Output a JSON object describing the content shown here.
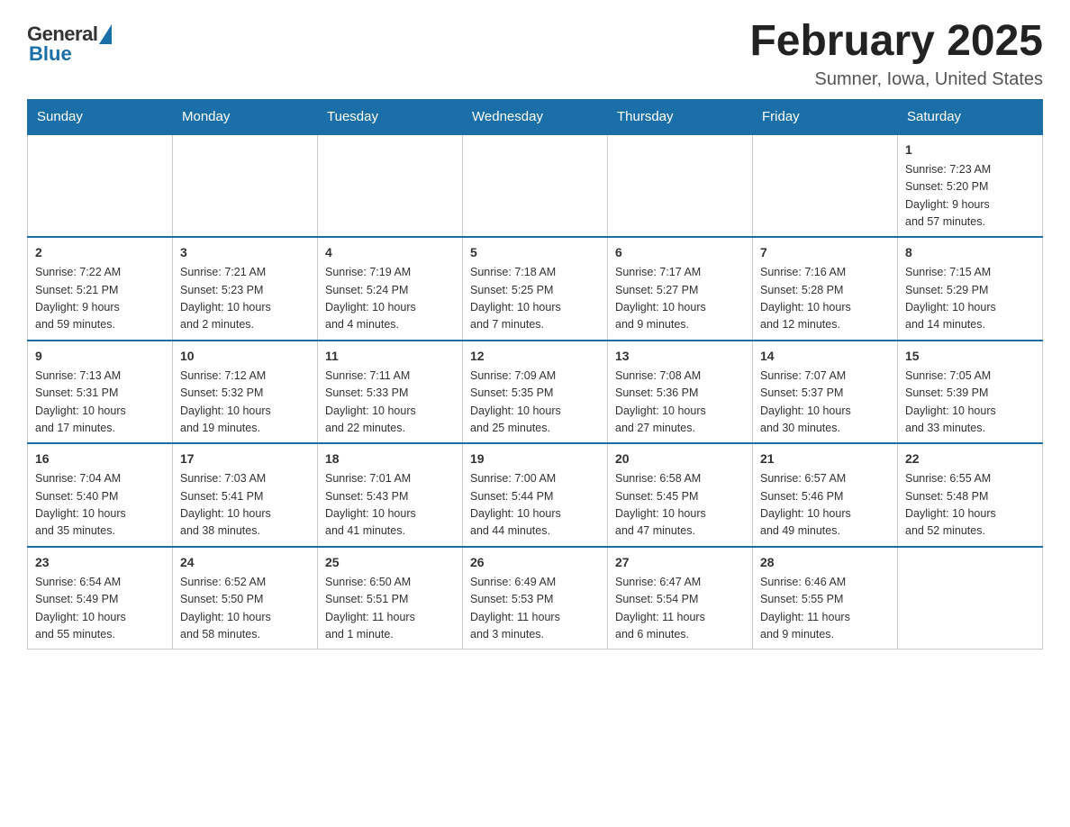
{
  "header": {
    "logo": {
      "general": "General",
      "blue": "Blue"
    },
    "title": "February 2025",
    "location": "Sumner, Iowa, United States"
  },
  "weekdays": [
    "Sunday",
    "Monday",
    "Tuesday",
    "Wednesday",
    "Thursday",
    "Friday",
    "Saturday"
  ],
  "weeks": [
    [
      {
        "day": "",
        "info": ""
      },
      {
        "day": "",
        "info": ""
      },
      {
        "day": "",
        "info": ""
      },
      {
        "day": "",
        "info": ""
      },
      {
        "day": "",
        "info": ""
      },
      {
        "day": "",
        "info": ""
      },
      {
        "day": "1",
        "info": "Sunrise: 7:23 AM\nSunset: 5:20 PM\nDaylight: 9 hours\nand 57 minutes."
      }
    ],
    [
      {
        "day": "2",
        "info": "Sunrise: 7:22 AM\nSunset: 5:21 PM\nDaylight: 9 hours\nand 59 minutes."
      },
      {
        "day": "3",
        "info": "Sunrise: 7:21 AM\nSunset: 5:23 PM\nDaylight: 10 hours\nand 2 minutes."
      },
      {
        "day": "4",
        "info": "Sunrise: 7:19 AM\nSunset: 5:24 PM\nDaylight: 10 hours\nand 4 minutes."
      },
      {
        "day": "5",
        "info": "Sunrise: 7:18 AM\nSunset: 5:25 PM\nDaylight: 10 hours\nand 7 minutes."
      },
      {
        "day": "6",
        "info": "Sunrise: 7:17 AM\nSunset: 5:27 PM\nDaylight: 10 hours\nand 9 minutes."
      },
      {
        "day": "7",
        "info": "Sunrise: 7:16 AM\nSunset: 5:28 PM\nDaylight: 10 hours\nand 12 minutes."
      },
      {
        "day": "8",
        "info": "Sunrise: 7:15 AM\nSunset: 5:29 PM\nDaylight: 10 hours\nand 14 minutes."
      }
    ],
    [
      {
        "day": "9",
        "info": "Sunrise: 7:13 AM\nSunset: 5:31 PM\nDaylight: 10 hours\nand 17 minutes."
      },
      {
        "day": "10",
        "info": "Sunrise: 7:12 AM\nSunset: 5:32 PM\nDaylight: 10 hours\nand 19 minutes."
      },
      {
        "day": "11",
        "info": "Sunrise: 7:11 AM\nSunset: 5:33 PM\nDaylight: 10 hours\nand 22 minutes."
      },
      {
        "day": "12",
        "info": "Sunrise: 7:09 AM\nSunset: 5:35 PM\nDaylight: 10 hours\nand 25 minutes."
      },
      {
        "day": "13",
        "info": "Sunrise: 7:08 AM\nSunset: 5:36 PM\nDaylight: 10 hours\nand 27 minutes."
      },
      {
        "day": "14",
        "info": "Sunrise: 7:07 AM\nSunset: 5:37 PM\nDaylight: 10 hours\nand 30 minutes."
      },
      {
        "day": "15",
        "info": "Sunrise: 7:05 AM\nSunset: 5:39 PM\nDaylight: 10 hours\nand 33 minutes."
      }
    ],
    [
      {
        "day": "16",
        "info": "Sunrise: 7:04 AM\nSunset: 5:40 PM\nDaylight: 10 hours\nand 35 minutes."
      },
      {
        "day": "17",
        "info": "Sunrise: 7:03 AM\nSunset: 5:41 PM\nDaylight: 10 hours\nand 38 minutes."
      },
      {
        "day": "18",
        "info": "Sunrise: 7:01 AM\nSunset: 5:43 PM\nDaylight: 10 hours\nand 41 minutes."
      },
      {
        "day": "19",
        "info": "Sunrise: 7:00 AM\nSunset: 5:44 PM\nDaylight: 10 hours\nand 44 minutes."
      },
      {
        "day": "20",
        "info": "Sunrise: 6:58 AM\nSunset: 5:45 PM\nDaylight: 10 hours\nand 47 minutes."
      },
      {
        "day": "21",
        "info": "Sunrise: 6:57 AM\nSunset: 5:46 PM\nDaylight: 10 hours\nand 49 minutes."
      },
      {
        "day": "22",
        "info": "Sunrise: 6:55 AM\nSunset: 5:48 PM\nDaylight: 10 hours\nand 52 minutes."
      }
    ],
    [
      {
        "day": "23",
        "info": "Sunrise: 6:54 AM\nSunset: 5:49 PM\nDaylight: 10 hours\nand 55 minutes."
      },
      {
        "day": "24",
        "info": "Sunrise: 6:52 AM\nSunset: 5:50 PM\nDaylight: 10 hours\nand 58 minutes."
      },
      {
        "day": "25",
        "info": "Sunrise: 6:50 AM\nSunset: 5:51 PM\nDaylight: 11 hours\nand 1 minute."
      },
      {
        "day": "26",
        "info": "Sunrise: 6:49 AM\nSunset: 5:53 PM\nDaylight: 11 hours\nand 3 minutes."
      },
      {
        "day": "27",
        "info": "Sunrise: 6:47 AM\nSunset: 5:54 PM\nDaylight: 11 hours\nand 6 minutes."
      },
      {
        "day": "28",
        "info": "Sunrise: 6:46 AM\nSunset: 5:55 PM\nDaylight: 11 hours\nand 9 minutes."
      },
      {
        "day": "",
        "info": ""
      }
    ]
  ]
}
